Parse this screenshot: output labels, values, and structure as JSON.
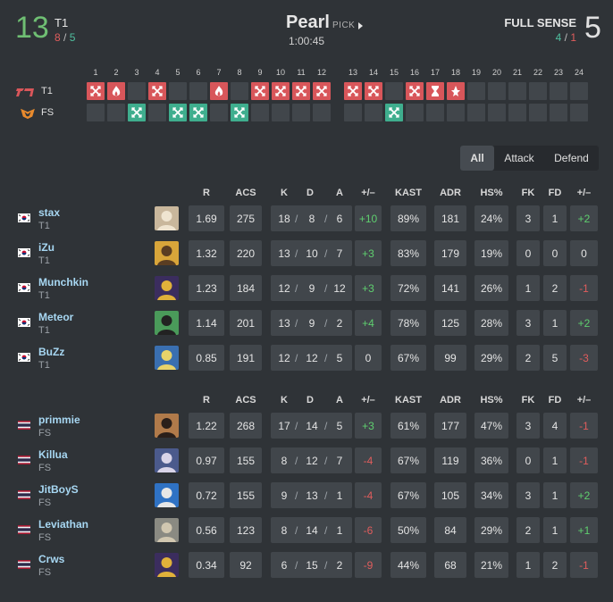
{
  "header": {
    "left_score": "13",
    "left_team": "T1",
    "left_atk": "8",
    "left_def": "5",
    "map": "Pearl",
    "pick": "PICK",
    "duration": "1:00:45",
    "right_team": "FULL SENSE",
    "right_def": "4",
    "right_atk": "1",
    "right_score": "5"
  },
  "rounds": {
    "numbers": [
      "1",
      "2",
      "3",
      "4",
      "5",
      "6",
      "7",
      "8",
      "9",
      "10",
      "11",
      "12",
      "13",
      "14",
      "15",
      "16",
      "17",
      "18",
      "19",
      "20",
      "21",
      "22",
      "23",
      "24"
    ],
    "teams": [
      {
        "label": "T1",
        "logo": "t1-logo-icon",
        "color": "#d8565a"
      },
      {
        "label": "FS",
        "logo": "fs-logo-icon",
        "color": "#e88a2d"
      }
    ],
    "results": [
      {
        "winner": "T1",
        "type": "elim"
      },
      {
        "winner": "T1",
        "type": "spike"
      },
      {
        "winner": "FS",
        "type": "elim"
      },
      {
        "winner": "T1",
        "type": "elim"
      },
      {
        "winner": "FS",
        "type": "elim"
      },
      {
        "winner": "FS",
        "type": "elim"
      },
      {
        "winner": "T1",
        "type": "spike"
      },
      {
        "winner": "FS",
        "type": "elim"
      },
      {
        "winner": "T1",
        "type": "elim"
      },
      {
        "winner": "T1",
        "type": "elim"
      },
      {
        "winner": "T1",
        "type": "elim"
      },
      {
        "winner": "T1",
        "type": "elim"
      },
      {
        "winner": "T1",
        "type": "elim"
      },
      {
        "winner": "T1",
        "type": "elim"
      },
      {
        "winner": "FS",
        "type": "elim"
      },
      {
        "winner": "T1",
        "type": "elim"
      },
      {
        "winner": "T1",
        "type": "time"
      },
      {
        "winner": "T1",
        "type": "defuse"
      },
      {
        "winner": "",
        "type": ""
      },
      {
        "winner": "",
        "type": ""
      },
      {
        "winner": "",
        "type": ""
      },
      {
        "winner": "",
        "type": ""
      },
      {
        "winner": "",
        "type": ""
      },
      {
        "winner": "",
        "type": ""
      }
    ]
  },
  "filter": {
    "options": [
      "All",
      "Attack",
      "Defend"
    ],
    "active": "All"
  },
  "columns": [
    "R",
    "ACS",
    "K",
    "D",
    "A",
    "+/–",
    "KAST",
    "ADR",
    "HS%",
    "FK",
    "FD",
    "+/–"
  ],
  "team1": [
    {
      "name": "stax",
      "team": "T1",
      "flag": "kr",
      "agent": "agent-icon",
      "r": "1.69",
      "acs": "275",
      "k": "18",
      "d": "8",
      "a": "6",
      "pm": "+10",
      "kast": "89%",
      "adr": "181",
      "hs": "24%",
      "fk": "3",
      "fd": "1",
      "fkpm": "+2"
    },
    {
      "name": "iZu",
      "team": "T1",
      "flag": "kr",
      "agent": "agent-icon",
      "r": "1.32",
      "acs": "220",
      "k": "13",
      "d": "10",
      "a": "7",
      "pm": "+3",
      "kast": "83%",
      "adr": "179",
      "hs": "19%",
      "fk": "0",
      "fd": "0",
      "fkpm": "0"
    },
    {
      "name": "Munchkin",
      "team": "T1",
      "flag": "kr",
      "agent": "agent-icon",
      "r": "1.23",
      "acs": "184",
      "k": "12",
      "d": "9",
      "a": "12",
      "pm": "+3",
      "kast": "72%",
      "adr": "141",
      "hs": "26%",
      "fk": "1",
      "fd": "2",
      "fkpm": "-1"
    },
    {
      "name": "Meteor",
      "team": "T1",
      "flag": "kr",
      "agent": "agent-icon",
      "r": "1.14",
      "acs": "201",
      "k": "13",
      "d": "9",
      "a": "2",
      "pm": "+4",
      "kast": "78%",
      "adr": "125",
      "hs": "28%",
      "fk": "3",
      "fd": "1",
      "fkpm": "+2"
    },
    {
      "name": "BuZz",
      "team": "T1",
      "flag": "kr",
      "agent": "agent-icon",
      "r": "0.85",
      "acs": "191",
      "k": "12",
      "d": "12",
      "a": "5",
      "pm": "0",
      "kast": "67%",
      "adr": "99",
      "hs": "29%",
      "fk": "2",
      "fd": "5",
      "fkpm": "-3"
    }
  ],
  "team2": [
    {
      "name": "primmie",
      "team": "FS",
      "flag": "th",
      "agent": "agent-icon",
      "r": "1.22",
      "acs": "268",
      "k": "17",
      "d": "14",
      "a": "5",
      "pm": "+3",
      "kast": "61%",
      "adr": "177",
      "hs": "47%",
      "fk": "3",
      "fd": "4",
      "fkpm": "-1"
    },
    {
      "name": "Killua",
      "team": "FS",
      "flag": "th",
      "agent": "agent-icon",
      "r": "0.97",
      "acs": "155",
      "k": "8",
      "d": "12",
      "a": "7",
      "pm": "-4",
      "kast": "67%",
      "adr": "119",
      "hs": "36%",
      "fk": "0",
      "fd": "1",
      "fkpm": "-1"
    },
    {
      "name": "JitBoyS",
      "team": "FS",
      "flag": "th",
      "agent": "agent-icon",
      "r": "0.72",
      "acs": "155",
      "k": "9",
      "d": "13",
      "a": "1",
      "pm": "-4",
      "kast": "67%",
      "adr": "105",
      "hs": "34%",
      "fk": "3",
      "fd": "1",
      "fkpm": "+2"
    },
    {
      "name": "Leviathan",
      "team": "FS",
      "flag": "th",
      "agent": "agent-icon",
      "r": "0.56",
      "acs": "123",
      "k": "8",
      "d": "14",
      "a": "1",
      "pm": "-6",
      "kast": "50%",
      "adr": "84",
      "hs": "29%",
      "fk": "2",
      "fd": "1",
      "fkpm": "+1"
    },
    {
      "name": "Crws",
      "team": "FS",
      "flag": "th",
      "agent": "agent-icon",
      "r": "0.34",
      "acs": "92",
      "k": "6",
      "d": "15",
      "a": "2",
      "pm": "-9",
      "kast": "44%",
      "adr": "68",
      "hs": "21%",
      "fk": "1",
      "fd": "2",
      "fkpm": "-1"
    }
  ],
  "colors": {
    "positive": "#5fcf6f",
    "negative": "#e05d5d",
    "t1_win": "#d8565a",
    "fs_win": "#3fae8e",
    "name": "#a7d7f2"
  }
}
